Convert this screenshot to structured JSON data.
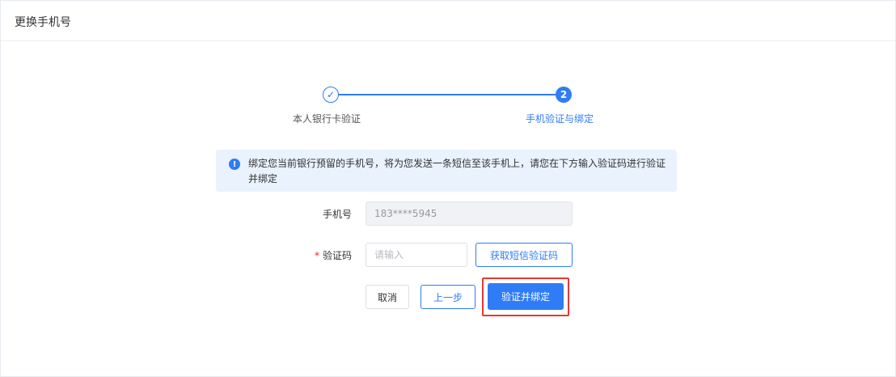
{
  "header": {
    "title": "更换手机号"
  },
  "steps": {
    "items": [
      {
        "label": "本人银行卡验证",
        "icon": "check-icon",
        "symbol": "✓",
        "status": "done"
      },
      {
        "label": "手机验证与绑定",
        "icon": "step-number",
        "symbol": "2",
        "status": "active"
      }
    ]
  },
  "notice": {
    "icon_symbol": "!",
    "text": "绑定您当前银行预留的手机号，将为您发送一条短信至该手机上，请您在下方输入验证码进行验证并绑定"
  },
  "form": {
    "phone_label": "手机号",
    "phone_value": "183****5945",
    "code_required_mark": "*",
    "code_label": "验证码",
    "code_placeholder": "请输入",
    "code_value": "",
    "get_code_label": "获取短信验证码"
  },
  "actions": {
    "cancel_label": "取消",
    "prev_label": "上一步",
    "submit_label": "验证并绑定"
  },
  "colors": {
    "accent": "#2f7cf6",
    "highlight": "#e53935",
    "notice_bg": "#e9f2fd"
  }
}
